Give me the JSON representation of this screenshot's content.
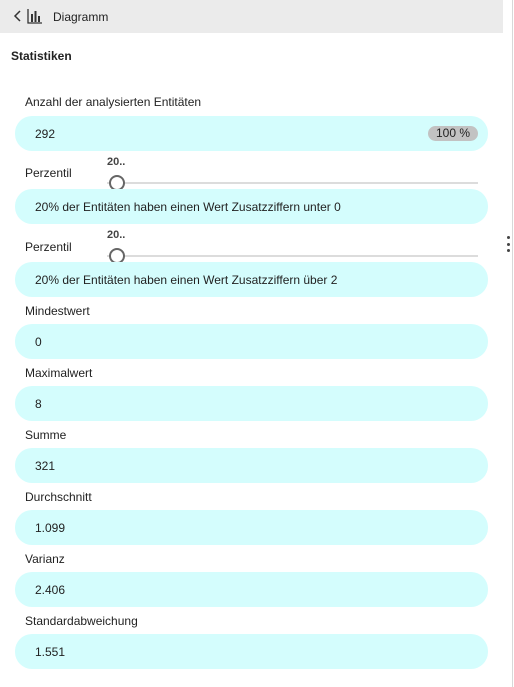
{
  "header": {
    "back_icon": "chevron-left-icon",
    "chart_icon": "bar-chart-icon",
    "title": "Diagramm"
  },
  "section_title": "Statistiken",
  "entities": {
    "label": "Anzahl der analysierten Entitäten",
    "value": "292",
    "badge": "100 %"
  },
  "percentile_low": {
    "label": "Perzentil",
    "slider_value": "20..",
    "slider_fraction": 0.02,
    "description": "20% der Entitäten haben einen Wert Zusatzziffern unter 0"
  },
  "percentile_high": {
    "label": "Perzentil",
    "slider_value": "20..",
    "slider_fraction": 0.02,
    "description": "20% der Entitäten haben einen Wert Zusatzziffern über 2"
  },
  "stats": {
    "min": {
      "label": "Mindestwert",
      "value": "0"
    },
    "max": {
      "label": "Maximalwert",
      "value": "8"
    },
    "sum": {
      "label": "Summe",
      "value": "321"
    },
    "avg": {
      "label": "Durchschnitt",
      "value": "1.099"
    },
    "variance": {
      "label": "Varianz",
      "value": "2.406"
    },
    "stddev": {
      "label": "Standardabweichung",
      "value": "1.551"
    }
  },
  "colors": {
    "field_bg": "#d4fdfd",
    "header_bg": "#ebebeb",
    "badge_bg": "#c2c2c2"
  }
}
